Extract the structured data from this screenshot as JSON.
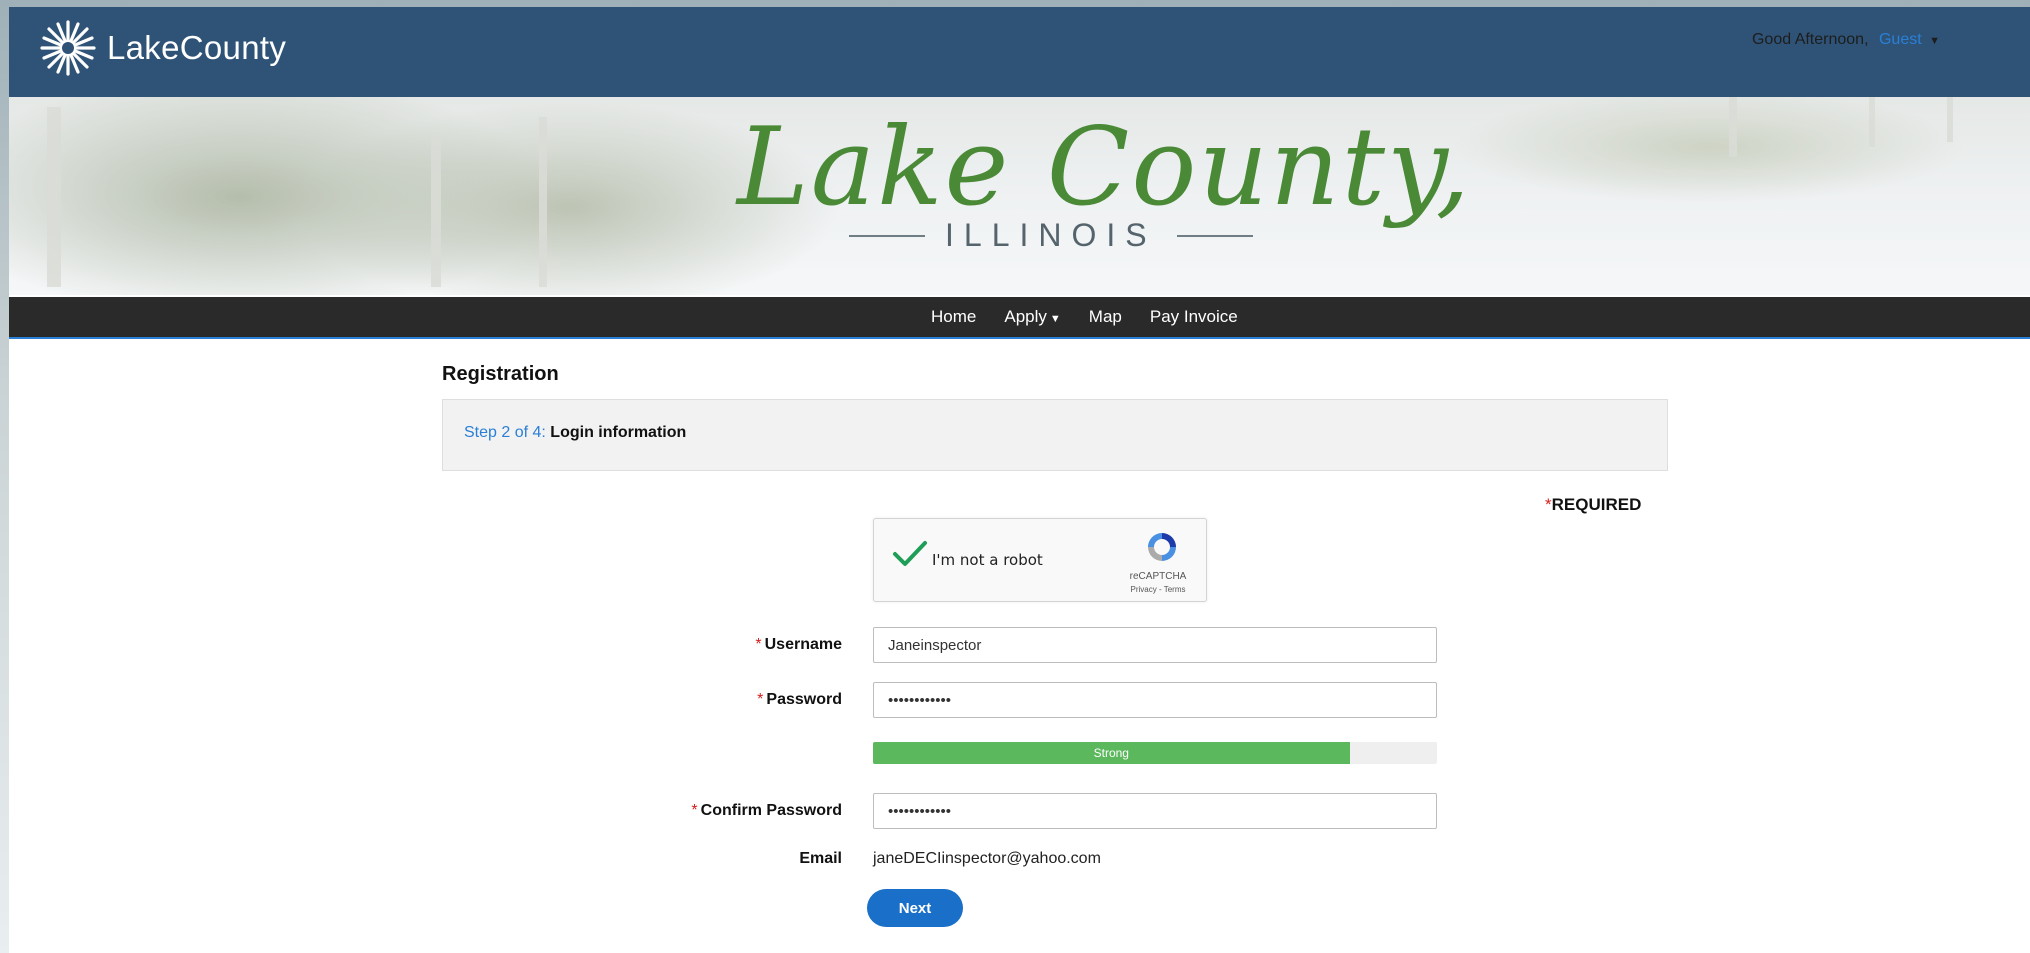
{
  "header": {
    "brand": "LakeCounty",
    "greeting": "Good Afternoon,",
    "user": "Guest"
  },
  "banner": {
    "title": "Lake County,",
    "subtitle": "ILLINOIS"
  },
  "nav": {
    "items": [
      "Home",
      "Apply",
      "Map",
      "Pay Invoice"
    ]
  },
  "page": {
    "title": "Registration",
    "step_number": "Step 2 of 4:",
    "step_name": "Login information",
    "required_star": "*",
    "required_label": "REQUIRED"
  },
  "captcha": {
    "label": "I'm not a robot",
    "brand": "reCAPTCHA",
    "links": "Privacy - Terms",
    "checked": true
  },
  "form": {
    "required_star": "*",
    "username_label": "Username",
    "username_value": "Janeinspector",
    "password_label": "Password",
    "password_value": "••••••••••••",
    "strength_label": "Strong",
    "strength_fraction": 0.845,
    "confirm_label": "Confirm Password",
    "confirm_value": "••••••••••••",
    "email_label": "Email",
    "email_value": "janeDECIinspector@yahoo.com",
    "next_label": "Next"
  },
  "colors": {
    "header_bg": "#2f5377",
    "nav_bg": "#2a2a2a",
    "accent": "#2a7fd6",
    "button": "#1a6fc8",
    "strength_fill": "#5cb85c",
    "script_green": "#4a8a37",
    "required_red": "#d31f1f"
  },
  "icons": {
    "logo": "lake-county-star-logo",
    "captcha_check": "checkmark-icon",
    "captcha_logo": "recaptcha-icon",
    "apply_caret": "caret-down-icon",
    "user_caret": "caret-down-icon"
  }
}
